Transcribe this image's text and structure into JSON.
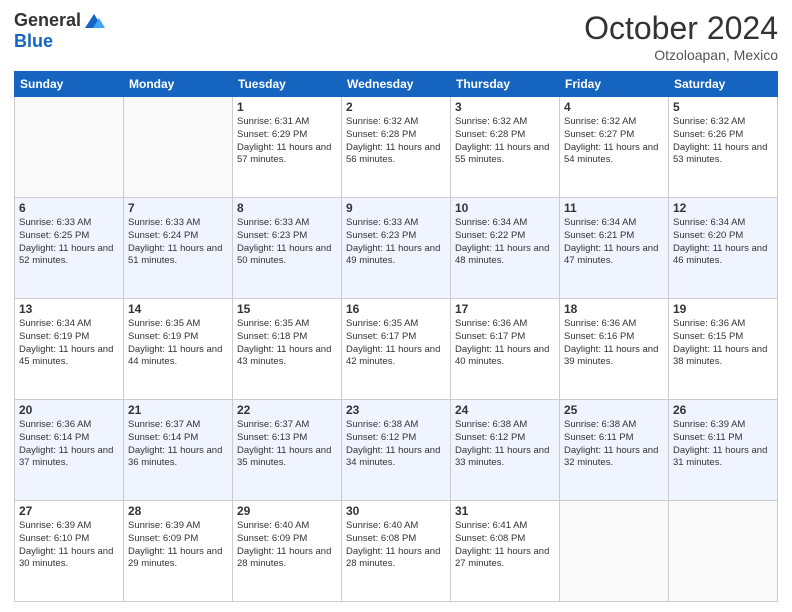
{
  "logo": {
    "general": "General",
    "blue": "Blue"
  },
  "header": {
    "month": "October 2024",
    "location": "Otzoloapan, Mexico"
  },
  "weekdays": [
    "Sunday",
    "Monday",
    "Tuesday",
    "Wednesday",
    "Thursday",
    "Friday",
    "Saturday"
  ],
  "weeks": [
    [
      {
        "day": "",
        "info": ""
      },
      {
        "day": "",
        "info": ""
      },
      {
        "day": "1",
        "info": "Sunrise: 6:31 AM\nSunset: 6:29 PM\nDaylight: 11 hours and 57 minutes."
      },
      {
        "day": "2",
        "info": "Sunrise: 6:32 AM\nSunset: 6:28 PM\nDaylight: 11 hours and 56 minutes."
      },
      {
        "day": "3",
        "info": "Sunrise: 6:32 AM\nSunset: 6:28 PM\nDaylight: 11 hours and 55 minutes."
      },
      {
        "day": "4",
        "info": "Sunrise: 6:32 AM\nSunset: 6:27 PM\nDaylight: 11 hours and 54 minutes."
      },
      {
        "day": "5",
        "info": "Sunrise: 6:32 AM\nSunset: 6:26 PM\nDaylight: 11 hours and 53 minutes."
      }
    ],
    [
      {
        "day": "6",
        "info": "Sunrise: 6:33 AM\nSunset: 6:25 PM\nDaylight: 11 hours and 52 minutes."
      },
      {
        "day": "7",
        "info": "Sunrise: 6:33 AM\nSunset: 6:24 PM\nDaylight: 11 hours and 51 minutes."
      },
      {
        "day": "8",
        "info": "Sunrise: 6:33 AM\nSunset: 6:23 PM\nDaylight: 11 hours and 50 minutes."
      },
      {
        "day": "9",
        "info": "Sunrise: 6:33 AM\nSunset: 6:23 PM\nDaylight: 11 hours and 49 minutes."
      },
      {
        "day": "10",
        "info": "Sunrise: 6:34 AM\nSunset: 6:22 PM\nDaylight: 11 hours and 48 minutes."
      },
      {
        "day": "11",
        "info": "Sunrise: 6:34 AM\nSunset: 6:21 PM\nDaylight: 11 hours and 47 minutes."
      },
      {
        "day": "12",
        "info": "Sunrise: 6:34 AM\nSunset: 6:20 PM\nDaylight: 11 hours and 46 minutes."
      }
    ],
    [
      {
        "day": "13",
        "info": "Sunrise: 6:34 AM\nSunset: 6:19 PM\nDaylight: 11 hours and 45 minutes."
      },
      {
        "day": "14",
        "info": "Sunrise: 6:35 AM\nSunset: 6:19 PM\nDaylight: 11 hours and 44 minutes."
      },
      {
        "day": "15",
        "info": "Sunrise: 6:35 AM\nSunset: 6:18 PM\nDaylight: 11 hours and 43 minutes."
      },
      {
        "day": "16",
        "info": "Sunrise: 6:35 AM\nSunset: 6:17 PM\nDaylight: 11 hours and 42 minutes."
      },
      {
        "day": "17",
        "info": "Sunrise: 6:36 AM\nSunset: 6:17 PM\nDaylight: 11 hours and 40 minutes."
      },
      {
        "day": "18",
        "info": "Sunrise: 6:36 AM\nSunset: 6:16 PM\nDaylight: 11 hours and 39 minutes."
      },
      {
        "day": "19",
        "info": "Sunrise: 6:36 AM\nSunset: 6:15 PM\nDaylight: 11 hours and 38 minutes."
      }
    ],
    [
      {
        "day": "20",
        "info": "Sunrise: 6:36 AM\nSunset: 6:14 PM\nDaylight: 11 hours and 37 minutes."
      },
      {
        "day": "21",
        "info": "Sunrise: 6:37 AM\nSunset: 6:14 PM\nDaylight: 11 hours and 36 minutes."
      },
      {
        "day": "22",
        "info": "Sunrise: 6:37 AM\nSunset: 6:13 PM\nDaylight: 11 hours and 35 minutes."
      },
      {
        "day": "23",
        "info": "Sunrise: 6:38 AM\nSunset: 6:12 PM\nDaylight: 11 hours and 34 minutes."
      },
      {
        "day": "24",
        "info": "Sunrise: 6:38 AM\nSunset: 6:12 PM\nDaylight: 11 hours and 33 minutes."
      },
      {
        "day": "25",
        "info": "Sunrise: 6:38 AM\nSunset: 6:11 PM\nDaylight: 11 hours and 32 minutes."
      },
      {
        "day": "26",
        "info": "Sunrise: 6:39 AM\nSunset: 6:11 PM\nDaylight: 11 hours and 31 minutes."
      }
    ],
    [
      {
        "day": "27",
        "info": "Sunrise: 6:39 AM\nSunset: 6:10 PM\nDaylight: 11 hours and 30 minutes."
      },
      {
        "day": "28",
        "info": "Sunrise: 6:39 AM\nSunset: 6:09 PM\nDaylight: 11 hours and 29 minutes."
      },
      {
        "day": "29",
        "info": "Sunrise: 6:40 AM\nSunset: 6:09 PM\nDaylight: 11 hours and 28 minutes."
      },
      {
        "day": "30",
        "info": "Sunrise: 6:40 AM\nSunset: 6:08 PM\nDaylight: 11 hours and 28 minutes."
      },
      {
        "day": "31",
        "info": "Sunrise: 6:41 AM\nSunset: 6:08 PM\nDaylight: 11 hours and 27 minutes."
      },
      {
        "day": "",
        "info": ""
      },
      {
        "day": "",
        "info": ""
      }
    ]
  ]
}
